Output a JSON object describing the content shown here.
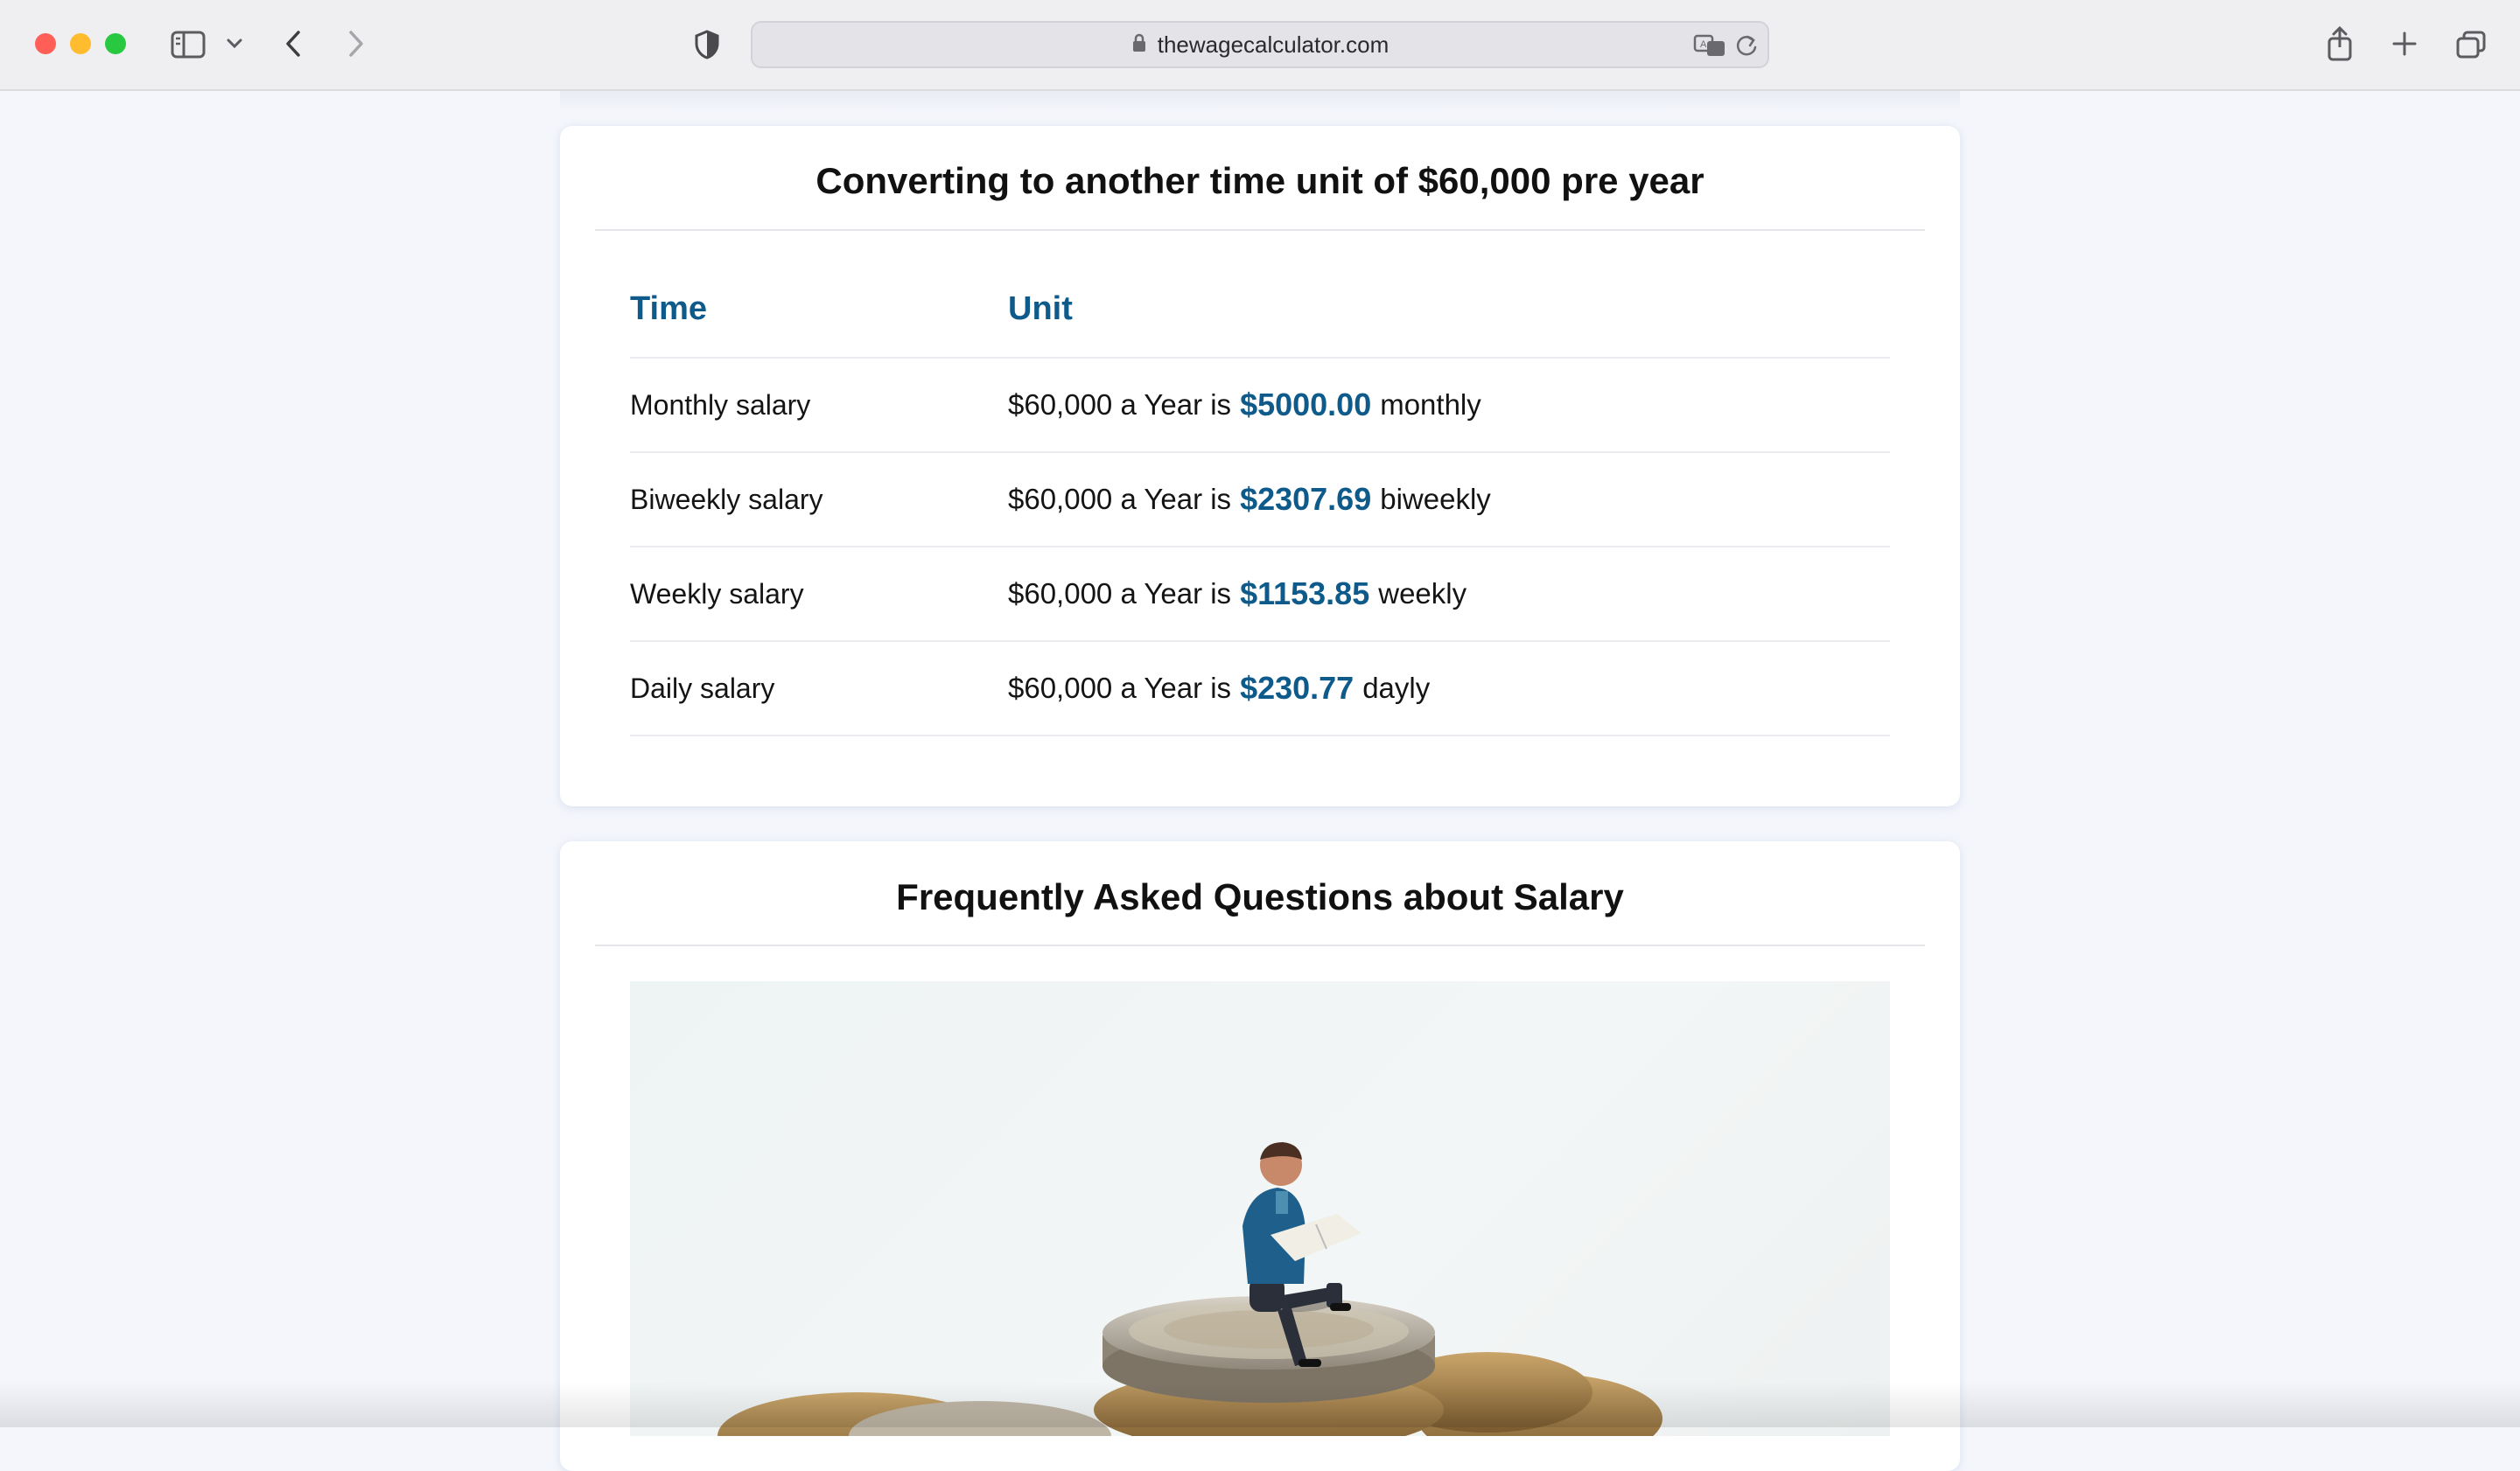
{
  "browser": {
    "url": "thewagecalculator.com",
    "colors": {
      "close": "#ff5f57",
      "minimize": "#febc2e",
      "zoom": "#28c840"
    },
    "icons": [
      "sidebar-icon",
      "chevron-down-icon",
      "back-icon",
      "forward-icon",
      "shield-icon",
      "lock-icon",
      "translate-icon",
      "reload-icon",
      "share-icon",
      "new-tab-icon",
      "tabs-overview-icon"
    ]
  },
  "conversion": {
    "title": "Converting to another time unit of $60,000 pre year",
    "headers": {
      "time": "Time",
      "unit": "Unit"
    },
    "rows": [
      {
        "time": "Monthly salary",
        "prefix": "$60,000 a Year is",
        "amount": "$5000.00",
        "suffix": "monthly"
      },
      {
        "time": "Biweekly salary",
        "prefix": "$60,000 a Year is",
        "amount": "$2307.69",
        "suffix": "biweekly"
      },
      {
        "time": "Weekly salary",
        "prefix": "$60,000 a Year is",
        "amount": "$1153.85",
        "suffix": "weekly"
      },
      {
        "time": "Daily salary",
        "prefix": "$60,000 a Year is",
        "amount": "$230.77",
        "suffix": "dayly"
      }
    ],
    "accent_color": "#0e5a8a"
  },
  "faq": {
    "title": "Frequently Asked Questions about Salary",
    "image_subject": "miniature figure reading newspaper on stack of coins"
  }
}
